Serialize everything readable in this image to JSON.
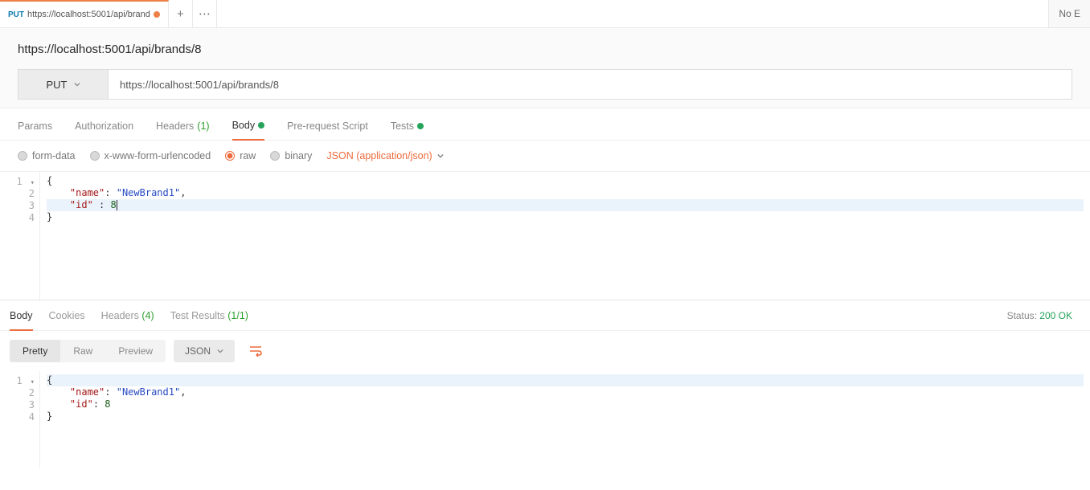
{
  "tab": {
    "method": "PUT",
    "label": "https://localhost:5001/api/brand"
  },
  "env_warning": "No E",
  "request": {
    "title": "https://localhost:5001/api/brands/8",
    "method": "PUT",
    "url": "https://localhost:5001/api/brands/8"
  },
  "req_tabs": {
    "params": "Params",
    "auth": "Authorization",
    "headers": "Headers",
    "headers_count": "(1)",
    "body": "Body",
    "prerequest": "Pre-request Script",
    "tests": "Tests"
  },
  "body_opts": {
    "formdata": "form-data",
    "urlencoded": "x-www-form-urlencoded",
    "raw": "raw",
    "binary": "binary",
    "content_type": "JSON (application/json)"
  },
  "req_body_lines": [
    {
      "n": "1",
      "brace": "{"
    },
    {
      "n": "2",
      "key": "\"name\"",
      "colon": ": ",
      "val": "\"NewBrand1\"",
      "comma": ","
    },
    {
      "n": "3",
      "key": "\"id\" ",
      "colon": ": ",
      "val": "8"
    },
    {
      "n": "4",
      "brace": "}"
    }
  ],
  "resp_tabs": {
    "body": "Body",
    "cookies": "Cookies",
    "headers": "Headers",
    "headers_count": "(4)",
    "tests": "Test Results",
    "tests_count": "(1/1)"
  },
  "status": {
    "label": "Status:",
    "value": "200 OK"
  },
  "resp_ctrl": {
    "pretty": "Pretty",
    "raw": "Raw",
    "preview": "Preview",
    "format": "JSON"
  },
  "resp_body_lines": [
    {
      "n": "1",
      "brace": "{"
    },
    {
      "n": "2",
      "key": "\"name\"",
      "colon": ": ",
      "val": "\"NewBrand1\"",
      "comma": ","
    },
    {
      "n": "3",
      "key": "\"id\"",
      "colon": ": ",
      "val": "8"
    },
    {
      "n": "4",
      "brace": "}"
    }
  ]
}
